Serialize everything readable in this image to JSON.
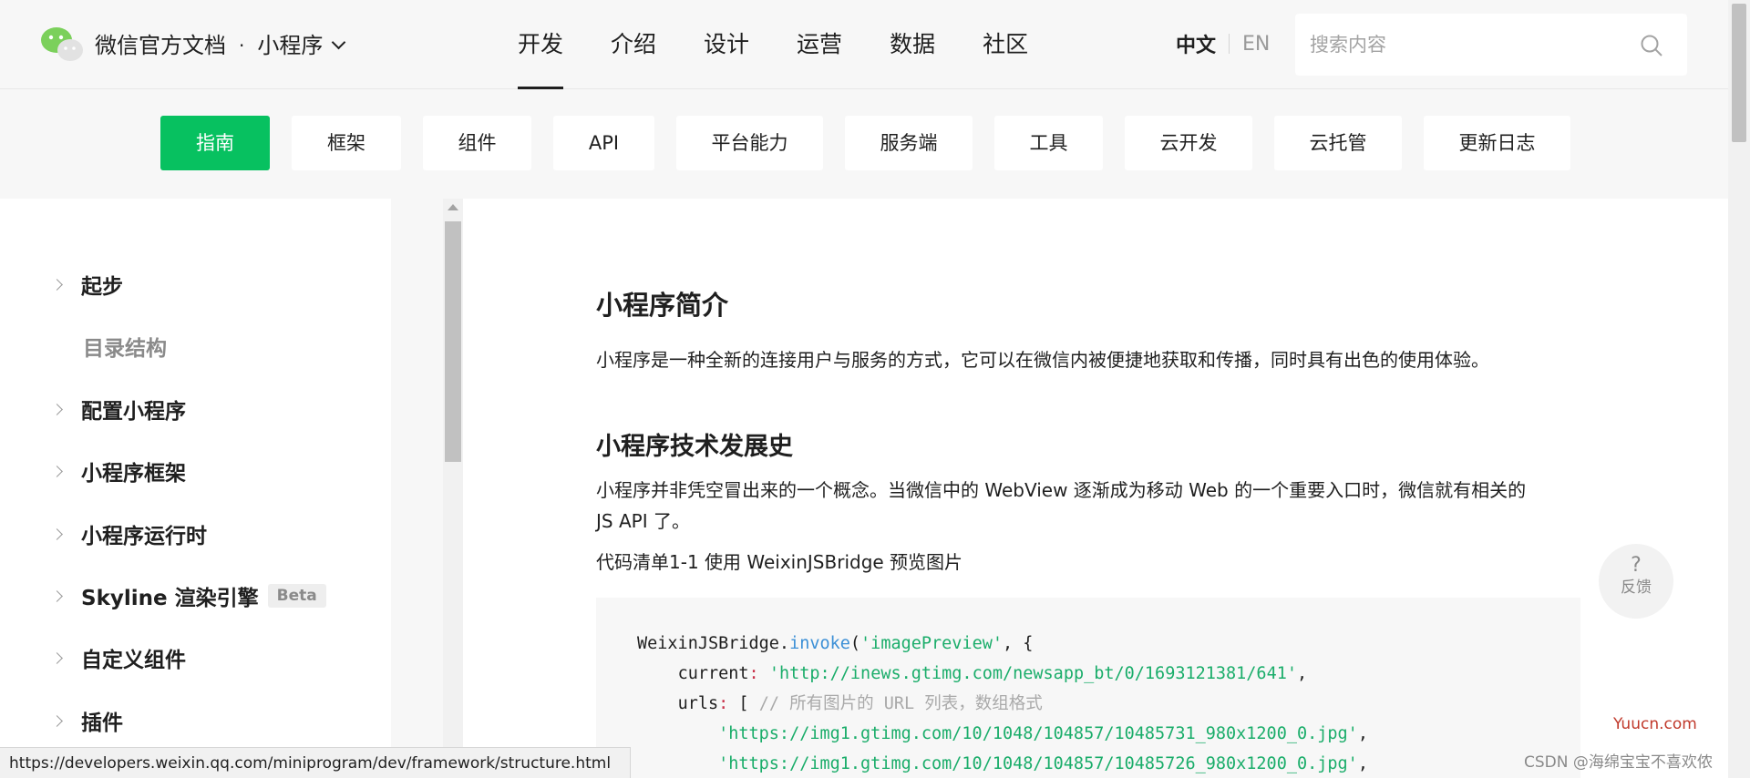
{
  "header": {
    "brand": "微信官方文档",
    "dot": "·",
    "product": "小程序",
    "nav": [
      "开发",
      "介绍",
      "设计",
      "运营",
      "数据",
      "社区"
    ],
    "active_nav": "开发",
    "lang_zh": "中文",
    "lang_en": "EN",
    "search_placeholder": "搜索内容",
    "colors": {
      "brand_green": "#07c160"
    }
  },
  "subnav": {
    "items": [
      {
        "label": "指南",
        "active": true
      },
      {
        "label": "框架"
      },
      {
        "label": "组件"
      },
      {
        "label": "API"
      },
      {
        "label": "平台能力"
      },
      {
        "label": "服务端"
      },
      {
        "label": "工具"
      },
      {
        "label": "云开发"
      },
      {
        "label": "云托管"
      },
      {
        "label": "更新日志"
      }
    ]
  },
  "sidebar": {
    "items": [
      {
        "label": "起步",
        "expandable": true
      },
      {
        "label": "目录结构",
        "expandable": false
      },
      {
        "label": "配置小程序",
        "expandable": true
      },
      {
        "label": "小程序框架",
        "expandable": true
      },
      {
        "label": "小程序运行时",
        "expandable": true
      },
      {
        "label": "Skyline 渲染引擎",
        "expandable": true,
        "badge": "Beta"
      },
      {
        "label": "自定义组件",
        "expandable": true
      },
      {
        "label": "插件",
        "expandable": true
      }
    ]
  },
  "main": {
    "title": "小程序简介",
    "intro": "小程序是一种全新的连接用户与服务的方式，它可以在微信内被便捷地获取和传播，同时具有出色的使用体验。",
    "h2": "小程序技术发展史",
    "para1_line1": "小程序并非凭空冒出来的一个概念。当微信中的 WebView 逐渐成为移动 Web 的一个重要入口时，微信就有相关的",
    "para1_line2": "JS API 了。",
    "listing": "代码清单1-1 使用 WeixinJSBridge 预览图片",
    "code": {
      "l1_obj": "WeixinJSBridge.",
      "l1_fn": "invoke",
      "l1_p": "(",
      "l1_s": "'imagePreview'",
      "l1_e": ", {",
      "l2_k": "current",
      "l2_c": ":",
      "l2_s": "'http://inews.gtimg.com/newsapp_bt/0/1693121381/641'",
      "l2_e": ",",
      "l3_k": "urls",
      "l3_c": ":",
      "l3_b": " [ ",
      "l3_cm": "// 所有图片的 URL 列表，数组格式",
      "l4_s": "'https://img1.gtimg.com/10/1048/104857/10485731_980x1200_0.jpg'",
      "l4_e": ",",
      "l5_s": "'https://img1.gtimg.com/10/1048/104857/10485726_980x1200_0.jpg'",
      "l5_e": ","
    }
  },
  "feedback": {
    "icon": "?",
    "label": "反馈"
  },
  "status_url": "https://developers.weixin.qq.com/miniprogram/dev/framework/structure.html",
  "watermark": {
    "site": "Yuucn.com",
    "author": "CSDN @海绵宝宝不喜欢侬"
  }
}
